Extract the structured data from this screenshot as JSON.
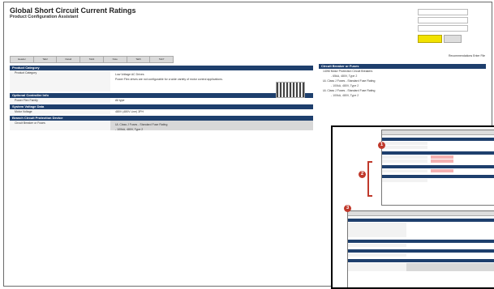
{
  "header": {
    "title": "Global Short Circuit Current Ratings",
    "subtitle": "Product Configuration Assistant"
  },
  "nav": {
    "tabs": [
      "Header",
      "Tab2",
      "Detail",
      "Tab4",
      "Note",
      "Tab6",
      "Tab7"
    ],
    "recommendations": "Recommendations Enter File"
  },
  "left": {
    "sections": [
      {
        "title": "Product Category",
        "rows": [
          {
            "label": "Product Category",
            "value": "Low Voltage AC Drives",
            "detail": "Power Flex drives are not configurable for a wide variety of motor control applications."
          }
        ]
      },
      {
        "title": "Optional Controller Info",
        "rows": [
          {
            "label": "Power Flex Family",
            "value": "All type"
          }
        ]
      },
      {
        "title": "System Voltage Data",
        "rows": [
          {
            "label": "Motor Voltage",
            "value": "480V (480V Line) 3PH"
          }
        ]
      },
      {
        "title": "Branch Circuit Protection Device",
        "rows": [
          {
            "label": "Circuit Breaker or Fuses",
            "value": "UL Class J Fuses - Standard Fuse Rating",
            "sub": "- 100kA, 480V, Type 2"
          }
        ]
      }
    ]
  },
  "right": {
    "title": "Circuit Breaker or Fuses",
    "items": [
      {
        "label": "140M Motor Protection Circuit Breakers",
        "sub": "- 65kA, 480V, Type 2"
      },
      {
        "label": "UL Class J Fuses - Standard Fuse Rating",
        "sub": "- 100kA, 480V, Type 2"
      },
      {
        "label": "UL Class J Fuses - Standard Fuse Rating",
        "sub": "- 100kA, 480V, Type 2"
      }
    ]
  },
  "overlay": {
    "badges": [
      "1",
      "2",
      "3"
    ]
  }
}
